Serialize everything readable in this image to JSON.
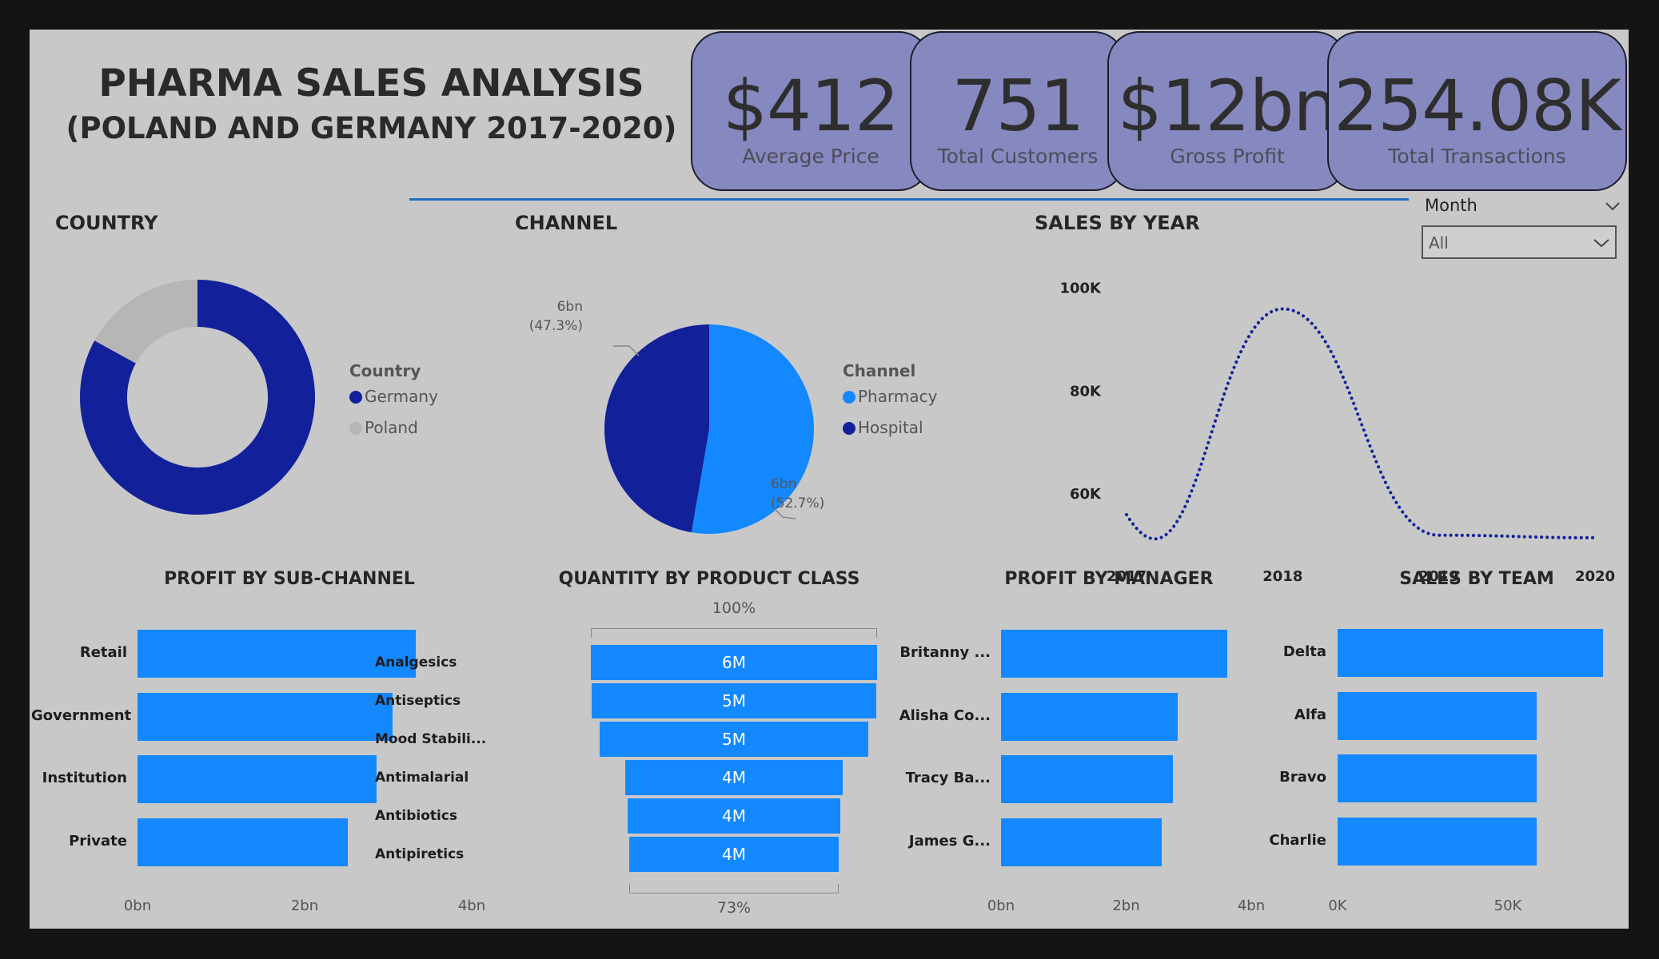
{
  "header": {
    "title_line1": "PHARMA SALES ANALYSIS",
    "title_line2": "(POLAND AND GERMANY 2017-2020)"
  },
  "kpis": [
    {
      "value": "$412",
      "label": "Average Price"
    },
    {
      "value": "751",
      "label": "Total Customers"
    },
    {
      "value": "$12bn",
      "label": "Gross Profit"
    },
    {
      "value": "254.08K",
      "label": "Total Transactions"
    }
  ],
  "slicer": {
    "label": "Month",
    "selected": "All"
  },
  "icons": {
    "dropdown": "chevron-down-icon"
  },
  "colors": {
    "dark_blue": "#12219a",
    "light_blue": "#1488ff",
    "grey": "#b6b6b6",
    "kpi_bg": "#8689bf"
  },
  "chart_data": [
    {
      "id": "country",
      "type": "pie",
      "title": "COUNTRY",
      "legend_title": "Country",
      "categories": [
        "Germany",
        "Poland"
      ],
      "values": [
        0.83,
        0.17
      ],
      "colors": [
        "#12219a",
        "#b6b6b6"
      ],
      "legend": "right"
    },
    {
      "id": "channel",
      "type": "pie",
      "title": "CHANNEL",
      "legend_title": "Channel",
      "categories": [
        "Pharmacy",
        "Hospital"
      ],
      "values": [
        52.7,
        47.3
      ],
      "data_labels": [
        [
          "6bn",
          "(52.7%)"
        ],
        [
          "6bn",
          "(47.3%)"
        ]
      ],
      "colors": [
        "#1488ff",
        "#12219a"
      ],
      "legend": "right"
    },
    {
      "id": "sales_by_year",
      "type": "line",
      "title": "SALES BY YEAR",
      "x": [
        2017,
        2018,
        2019,
        2020
      ],
      "x_labels": [
        "2017",
        "2018",
        "2019",
        "2020"
      ],
      "values": [
        56000,
        96000,
        52000,
        51500
      ],
      "y_ticks": [
        {
          "v": 60000,
          "label": "60K"
        },
        {
          "v": 80000,
          "label": "80K"
        },
        {
          "v": 100000,
          "label": "100K"
        }
      ],
      "ylim": [
        49000,
        104000
      ],
      "style": "dotted",
      "color": "#12219a"
    },
    {
      "id": "profit_by_subchannel",
      "type": "bar",
      "orientation": "horizontal",
      "title": "PROFIT BY SUB-CHANNEL",
      "categories": [
        "Retail",
        "Government",
        "Institution",
        "Private"
      ],
      "values": [
        3.33,
        3.05,
        2.86,
        2.52
      ],
      "xlim": [
        0,
        4
      ],
      "x_ticks": [
        {
          "v": 0,
          "label": "0bn"
        },
        {
          "v": 2,
          "label": "2bn"
        },
        {
          "v": 4,
          "label": "4bn"
        }
      ]
    },
    {
      "id": "quantity_by_product_class",
      "type": "funnel",
      "title": "QUANTITY BY PRODUCT CLASS",
      "categories": [
        "Analgesics",
        "Antiseptics",
        "Mood Stabili...",
        "Antimalarial",
        "Antibiotics",
        "Antipiretics"
      ],
      "values": [
        5.94,
        5.9,
        5.56,
        4.51,
        4.41,
        4.34
      ],
      "value_labels": [
        "6M",
        "5M",
        "5M",
        "4M",
        "4M",
        "4M"
      ],
      "top_label": "100%",
      "bottom_label": "73%"
    },
    {
      "id": "profit_by_manager",
      "type": "bar",
      "orientation": "horizontal",
      "title": "PROFIT BY MANAGER",
      "categories": [
        "Britanny ...",
        "Alisha Co...",
        "Tracy Ba...",
        "James G..."
      ],
      "values": [
        3.62,
        2.82,
        2.75,
        2.57
      ],
      "xlim": [
        0,
        4
      ],
      "x_ticks": [
        {
          "v": 0,
          "label": "0bn"
        },
        {
          "v": 2,
          "label": "2bn"
        },
        {
          "v": 4,
          "label": "4bn"
        }
      ]
    },
    {
      "id": "sales_by_team",
      "type": "bar",
      "orientation": "horizontal",
      "title": "SALES BY TEAM",
      "categories": [
        "Delta",
        "Alfa",
        "Bravo",
        "Charlie"
      ],
      "values": [
        78000,
        58500,
        58500,
        58500
      ],
      "xlim": [
        0,
        100000
      ],
      "x_ticks": [
        {
          "v": 0,
          "label": "0K"
        },
        {
          "v": 50000,
          "label": "50K"
        }
      ]
    }
  ]
}
